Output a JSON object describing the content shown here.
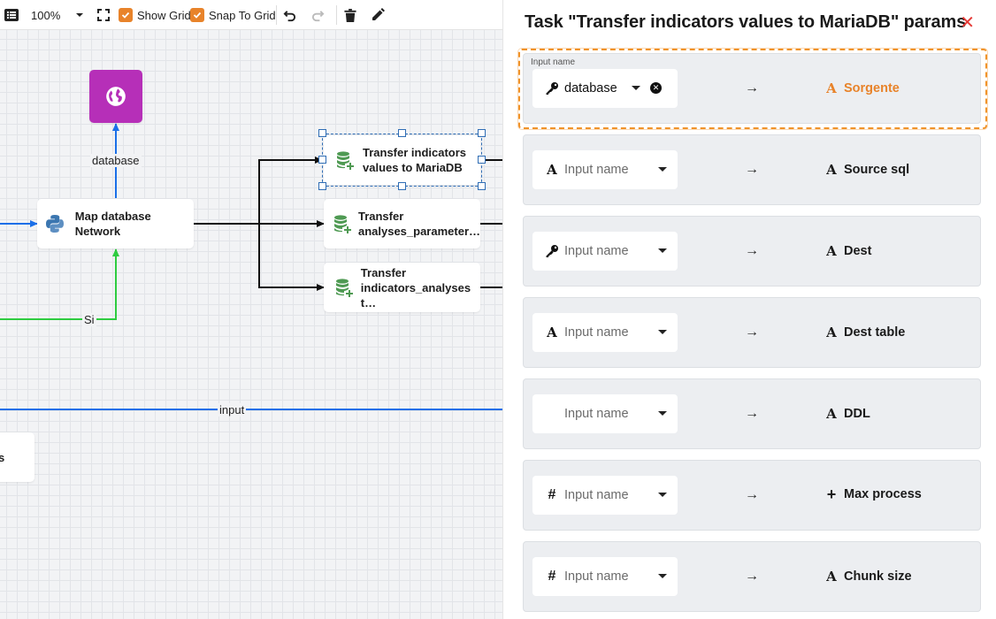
{
  "toolbar": {
    "menu_icon": "list-icon",
    "zoom_value": "100%",
    "fit_icon": "fullscreen-icon",
    "show_grid_label": "Show Grid",
    "show_grid_checked": true,
    "snap_label": "Snap To Grid",
    "snap_checked": true,
    "undo_icon": "undo-icon",
    "redo_icon": "redo-icon",
    "delete_icon": "trash-icon",
    "edit_icon": "pencil-icon"
  },
  "canvas": {
    "nodes": {
      "globe": {
        "icon": "globe-icon",
        "color": "#b62fb8"
      },
      "map_db": {
        "label": "Map database Network",
        "icon": "python-icon"
      },
      "transfer1": {
        "label_line1": "Transfer indicators",
        "label_line2": "values to MariaDB",
        "icon": "database-add-icon",
        "selected": true
      },
      "transfer2": {
        "label_line1": "Transfer",
        "label_line2": "analyses_parameter…",
        "icon": "database-add-icon"
      },
      "transfer3": {
        "label_line1": "Transfer",
        "label_line2": "indicators_analyses t…",
        "icon": "database-add-icon"
      },
      "partial": {
        "label": "s"
      }
    },
    "edge_labels": {
      "database": "database",
      "si": "Si",
      "input": "input"
    },
    "colors": {
      "blue_edge": "#1a6fe8",
      "green_edge": "#2ecc40",
      "black_edge": "#111111"
    }
  },
  "panel": {
    "title": "Task \"Transfer indicators values to MariaDB\" params",
    "close_icon": "close-icon",
    "focused_label": "Input name",
    "rows": [
      {
        "input_icon": "key-icon",
        "input_value": "database",
        "has_clear": true,
        "placeholder": "",
        "target_icon": "text-icon",
        "target": "Sorgente",
        "active": true
      },
      {
        "input_icon": "text-icon",
        "input_value": "",
        "placeholder": "Input name",
        "target_icon": "text-icon",
        "target": "Source sql"
      },
      {
        "input_icon": "key-icon",
        "input_value": "",
        "placeholder": "Input name",
        "target_icon": "text-icon",
        "target": "Dest"
      },
      {
        "input_icon": "text-icon",
        "input_value": "",
        "placeholder": "Input name",
        "target_icon": "text-icon",
        "target": "Dest table"
      },
      {
        "input_icon": "",
        "input_value": "",
        "placeholder": "Input name",
        "target_icon": "text-icon",
        "target": "DDL"
      },
      {
        "input_icon": "hash-icon",
        "input_value": "",
        "placeholder": "Input name",
        "target_icon": "plus-icon",
        "target": "Max process"
      },
      {
        "input_icon": "hash-icon",
        "input_value": "",
        "placeholder": "Input name",
        "target_icon": "text-icon",
        "target": "Chunk size"
      }
    ],
    "arrow_glyph": "→",
    "accent": "#e8832a"
  }
}
